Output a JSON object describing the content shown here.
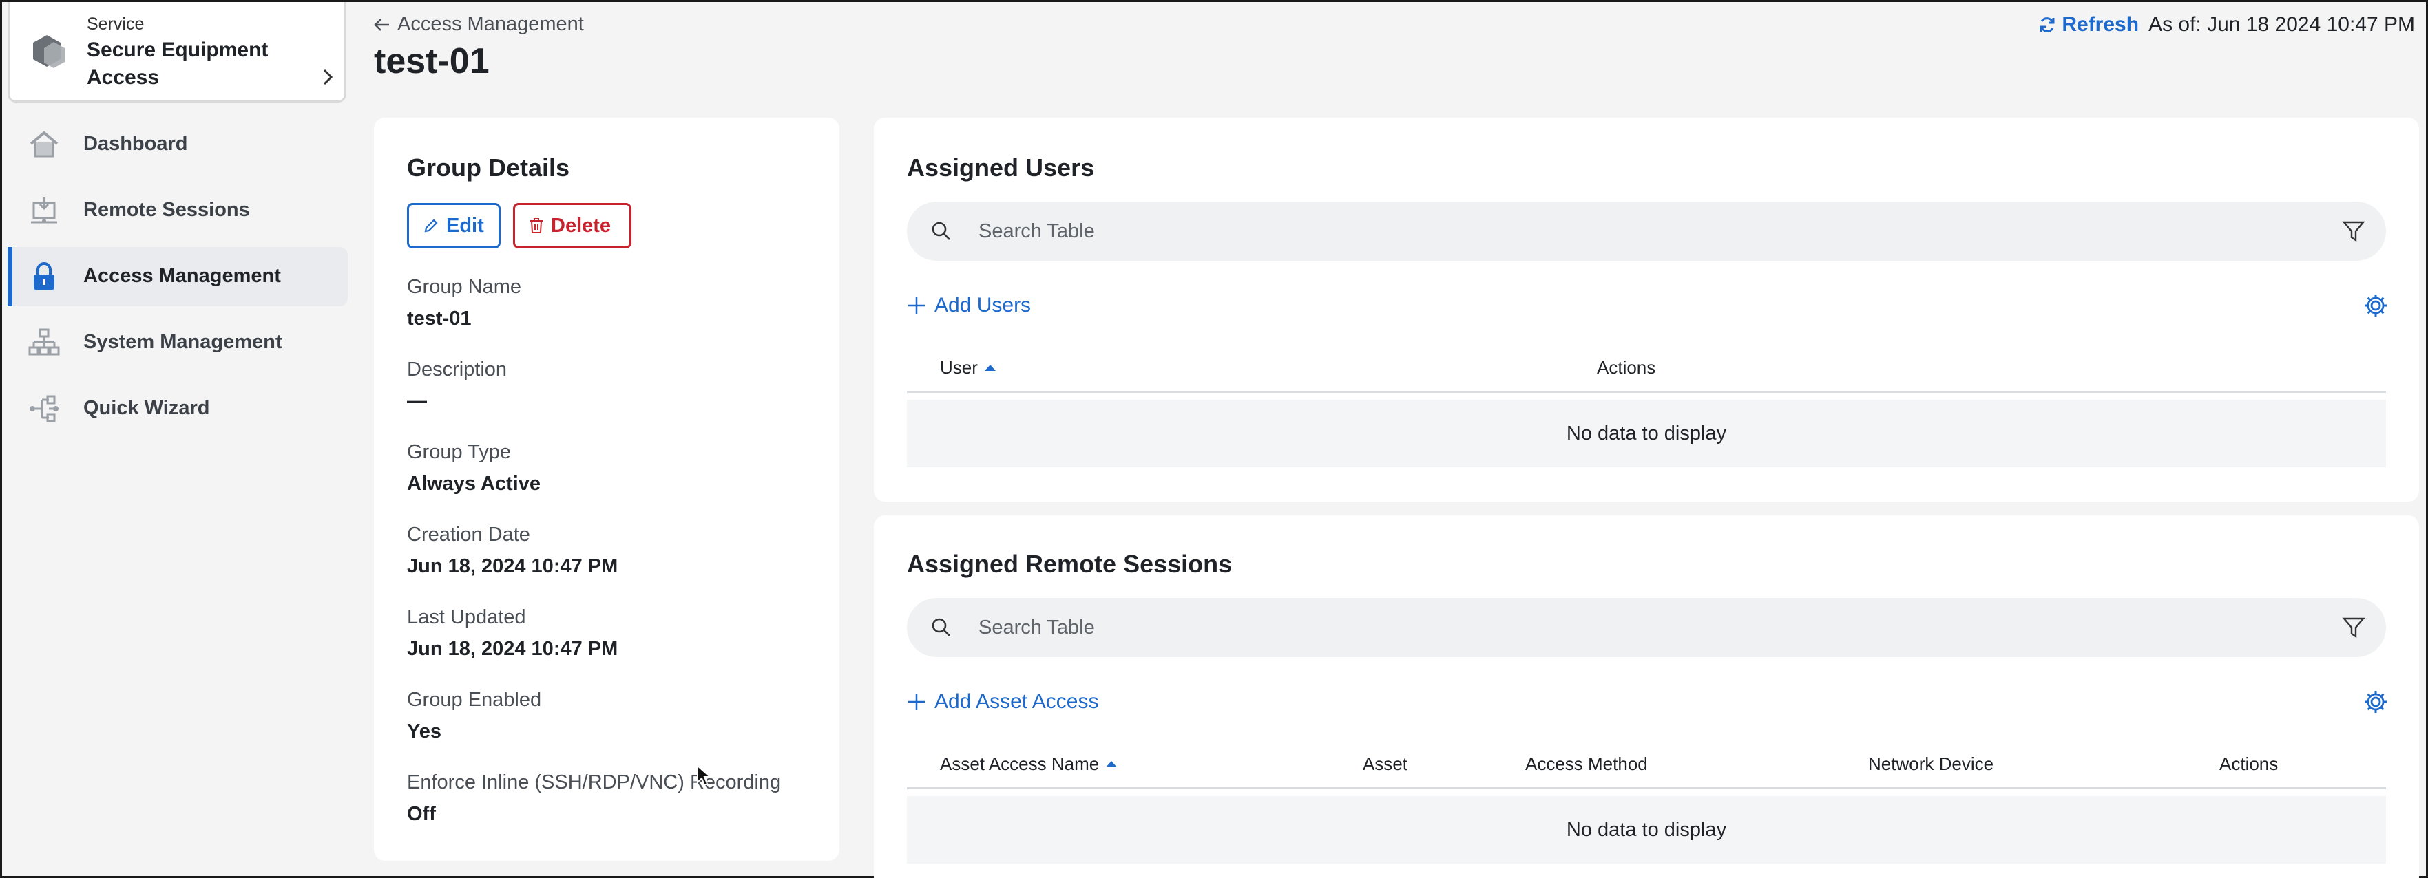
{
  "service": {
    "kicker": "Service",
    "name": "Secure Equipment Access"
  },
  "nav": {
    "items": [
      {
        "label": "Dashboard",
        "icon": "home-icon"
      },
      {
        "label": "Remote Sessions",
        "icon": "remote-sessions-icon"
      },
      {
        "label": "Access Management",
        "icon": "lock-icon",
        "active": true
      },
      {
        "label": "System Management",
        "icon": "network-icon"
      },
      {
        "label": "Quick Wizard",
        "icon": "wizard-icon"
      }
    ]
  },
  "header": {
    "breadcrumb": "Access Management",
    "title": "test-01",
    "refresh_label": "Refresh",
    "as_of": "As of: Jun 18 2024 10:47 PM"
  },
  "group_details": {
    "title": "Group Details",
    "edit_label": "Edit",
    "delete_label": "Delete",
    "fields": [
      {
        "label": "Group Name",
        "value": "test-01"
      },
      {
        "label": "Description",
        "value": "—"
      },
      {
        "label": "Group Type",
        "value": "Always Active"
      },
      {
        "label": "Creation Date",
        "value": "Jun 18, 2024 10:47 PM"
      },
      {
        "label": "Last Updated",
        "value": "Jun 18, 2024 10:47 PM"
      },
      {
        "label": "Group Enabled",
        "value": "Yes"
      },
      {
        "label": "Enforce Inline (SSH/RDP/VNC) Recording",
        "value": "Off"
      }
    ]
  },
  "assigned_users": {
    "title": "Assigned Users",
    "search_placeholder": "Search Table",
    "add_label": "Add Users",
    "columns": [
      "User",
      "Actions"
    ],
    "empty_text": "No data to display"
  },
  "assigned_sessions": {
    "title": "Assigned Remote Sessions",
    "search_placeholder": "Search Table",
    "add_label": "Add Asset Access",
    "columns": [
      "Asset Access Name",
      "Asset",
      "Access Method",
      "Network Device",
      "Actions"
    ],
    "empty_text": "No data to display"
  },
  "colors": {
    "accent": "#1d69cc",
    "danger": "#c8232c",
    "background": "#f4f4f4"
  }
}
